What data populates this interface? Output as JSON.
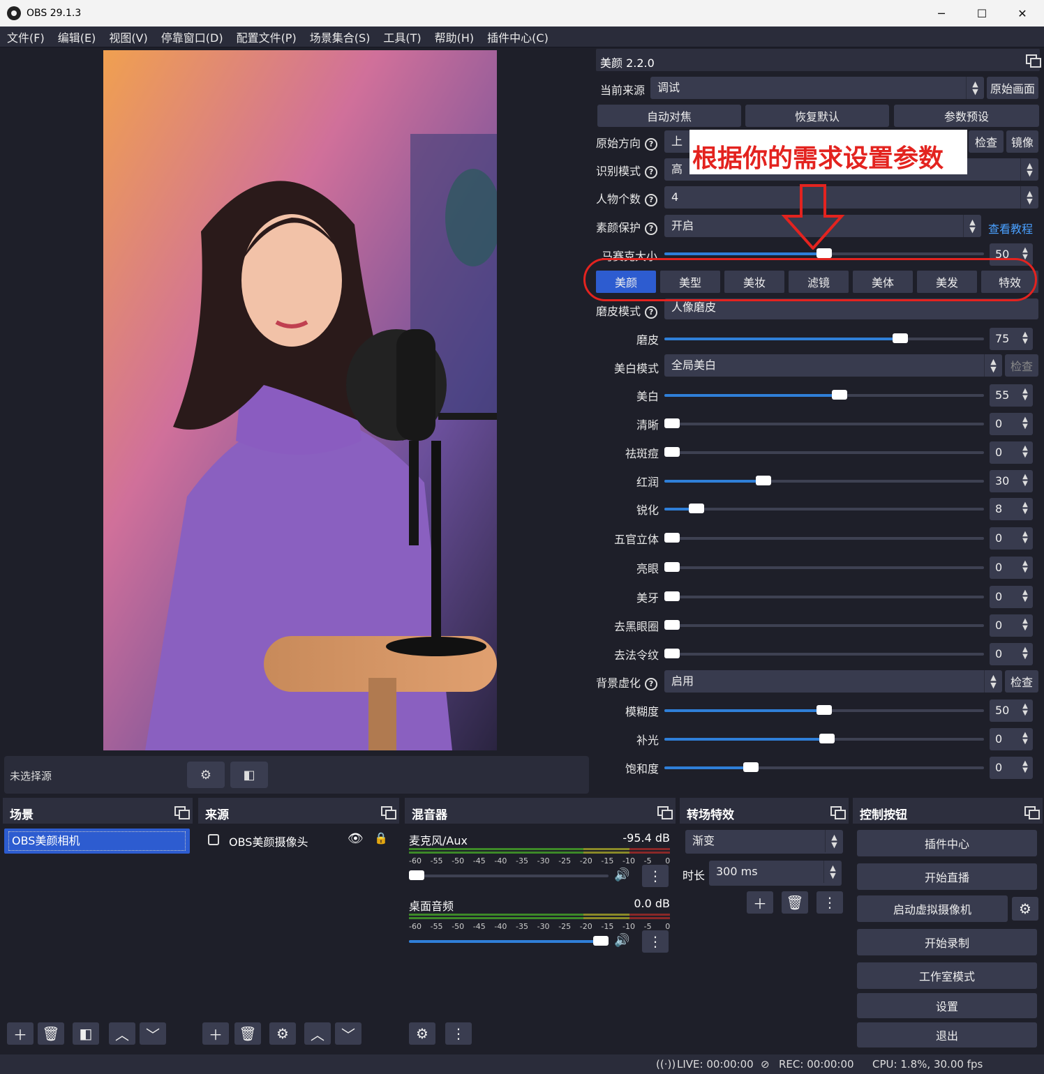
{
  "window": {
    "title": "OBS 29.1.3",
    "minimize": "─",
    "maximize": "☐",
    "close": "✕"
  },
  "menu": [
    "文件(F)",
    "编辑(E)",
    "视图(V)",
    "停靠窗口(D)",
    "配置文件(P)",
    "场景集合(S)",
    "工具(T)",
    "帮助(H)",
    "插件中心(C)"
  ],
  "preview_toolbar": {
    "label": "未选择源"
  },
  "plugin": {
    "title": "美颜 2.2.0",
    "current_source_label": "当前来源",
    "current_source_value": "调试",
    "original_view_button": "原始画面",
    "auto_focus_button": "自动对焦",
    "reset_button": "恢复默认",
    "preset_button": "参数预设",
    "orientation_label": "原始方向",
    "orientation_value": "上",
    "check_button": "检查",
    "mirror_button": "镜像",
    "recognition_label": "识别模式",
    "recognition_value": "高",
    "people_label": "人物个数",
    "people_value": "4",
    "protect_label": "素颜保护",
    "protect_value": "开启",
    "tutorial_link": "查看教程",
    "mosaic_label": "马赛克大小",
    "mosaic_value": "50",
    "tabs": [
      "美颜",
      "美型",
      "美妆",
      "滤镜",
      "美体",
      "美发",
      "特效"
    ],
    "smooth_mode_label": "磨皮模式",
    "smooth_mode_value": "人像磨皮",
    "whiten_mode_label": "美白模式",
    "whiten_mode_value": "全局美白",
    "whiten_check": "检查",
    "bg_blur_label": "背景虚化",
    "bg_blur_value": "启用",
    "bg_check": "检查",
    "sliders": [
      {
        "label": "磨皮",
        "value": 75,
        "display": "75"
      },
      {
        "label": "美白",
        "value": 55,
        "display": "55"
      },
      {
        "label": "清晰",
        "value": 0,
        "display": "0"
      },
      {
        "label": "祛斑痘",
        "value": 0,
        "display": "0"
      },
      {
        "label": "红润",
        "value": 30,
        "display": "30"
      },
      {
        "label": "锐化",
        "value": 8,
        "display": "8"
      },
      {
        "label": "五官立体",
        "value": 0,
        "display": "0"
      },
      {
        "label": "亮眼",
        "value": 0,
        "display": "0"
      },
      {
        "label": "美牙",
        "value": 0,
        "display": "0"
      },
      {
        "label": "去黑眼圈",
        "value": 0,
        "display": "0"
      },
      {
        "label": "去法令纹",
        "value": 0,
        "display": "0"
      }
    ],
    "bg_sliders": [
      {
        "label": "模糊度",
        "value": 50,
        "display": "50"
      },
      {
        "label": "补光",
        "value": 51,
        "display": "0"
      },
      {
        "label": "饱和度",
        "value": 26,
        "display": "0"
      }
    ],
    "annotation": "根据你的需求设置参数"
  },
  "docks": {
    "scenes": {
      "title": "场景",
      "items": [
        "OBS美颜相机"
      ]
    },
    "sources": {
      "title": "来源",
      "items": [
        "OBS美颜摄像头"
      ]
    },
    "mixer": {
      "title": "混音器",
      "channels": [
        {
          "name": "麦克风/Aux",
          "db": "-95.4 dB",
          "volume": 0
        },
        {
          "name": "桌面音频",
          "db": "0.0 dB",
          "volume": 100
        }
      ],
      "ticks": [
        "-60",
        "-55",
        "-50",
        "-45",
        "-40",
        "-35",
        "-30",
        "-25",
        "-20",
        "-15",
        "-10",
        "-5",
        "0"
      ]
    },
    "transitions": {
      "title": "转场特效",
      "type": "渐变",
      "duration_label": "时长",
      "duration": "300 ms"
    },
    "controls": {
      "title": "控制按钮",
      "buttons": [
        "插件中心",
        "开始直播",
        "启动虚拟摄像机",
        "开始录制",
        "工作室模式",
        "设置",
        "退出"
      ]
    }
  },
  "status": {
    "live": "LIVE: 00:00:00",
    "rec": "REC: 00:00:00",
    "cpu": "CPU: 1.8%, 30.00 fps"
  }
}
